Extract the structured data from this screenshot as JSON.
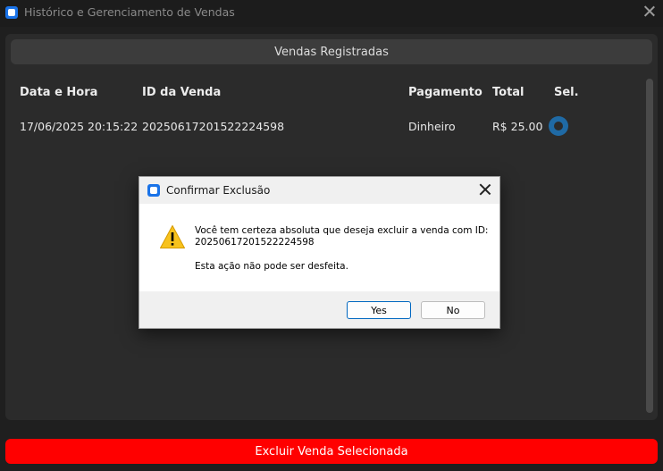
{
  "window": {
    "title": "Histórico e Gerenciamento de Vendas",
    "icon": "app-icon",
    "close_icon": "close-icon"
  },
  "section": {
    "header": "Vendas Registradas"
  },
  "table": {
    "columns": [
      "Data e Hora",
      "ID da Venda",
      "Pagamento",
      "Total",
      "Sel."
    ],
    "rows": [
      {
        "datetime": "17/06/2025 20:15:22",
        "sale_id": "20250617201522224598",
        "payment": "Dinheiro",
        "total": "R$ 25.00",
        "selected": true
      }
    ]
  },
  "delete_button": {
    "label": "Excluir Venda Selecionada",
    "color": "#ff0000"
  },
  "dialog": {
    "title": "Confirmar Exclusão",
    "icon": "warning-icon",
    "message_line1": "Você tem certeza absoluta que deseja excluir a venda com ID:",
    "message_line2": "20250617201522224598",
    "message_line3": "Esta ação não pode ser desfeita.",
    "yes_label": "Yes",
    "no_label": "No"
  },
  "colors": {
    "accent": "#1f6aa5",
    "danger": "#ff0000",
    "background": "#1f1f1f",
    "panel": "#2b2b2b"
  }
}
